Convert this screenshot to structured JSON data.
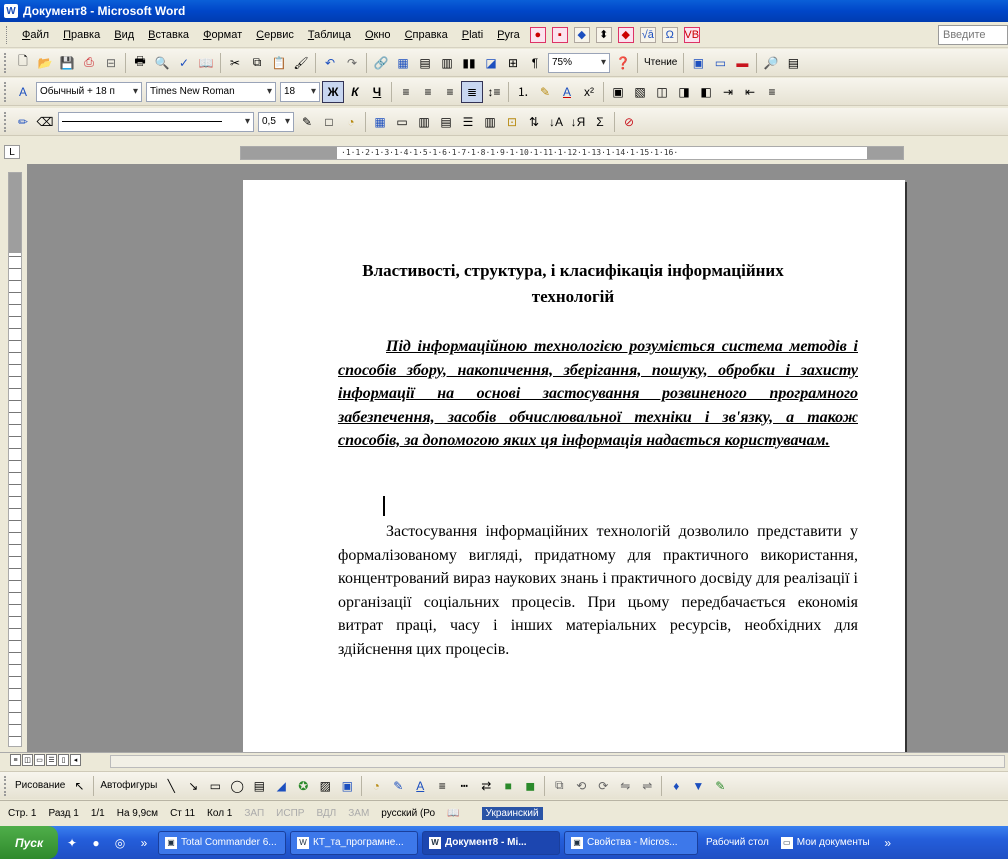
{
  "window": {
    "title": "Документ8 - Microsoft Word"
  },
  "menu": {
    "items": [
      "Файл",
      "Правка",
      "Вид",
      "Вставка",
      "Формат",
      "Сервис",
      "Таблица",
      "Окно",
      "Справка",
      "Plati",
      "Pyra"
    ],
    "help_placeholder": "Введите"
  },
  "toolbar_standard": {
    "zoom": "75%",
    "read_label": "Чтение"
  },
  "toolbar_formatting": {
    "style": "Обычный + 18 п",
    "font": "Times New Roman",
    "size": "18"
  },
  "toolbar_tables": {
    "line_weight": "0,5"
  },
  "ruler": {
    "marks": "·1·1·2·1·3·1·4·1·5·1·6·1·7·1·8·1·9·1·10·1·11·1·12·1·13·1·14·1·15·1·16·"
  },
  "document": {
    "title": "Властивості, структура, і класифікація інформаційних технологій",
    "definition": "Під інформаційною технологією розуміється система методів і способів збору, накопичення, зберігання, пошуку, обробки і захисту інформації на основі застосування розвиненого програмного забезпечення, засобів обчислювальної техніки і зв'язку, а також способів, за допомогою яких ця інформація надається користувачам.",
    "body": "Застосування інформаційних технологій дозволило представити у формалізованому вигляді, придатному для практичного використання, концентрований вираз наукових знань і практичного досвіду для реалізації і організації соціальних процесів. При цьому передбачається економія витрат праці, часу і інших матеріальних ресурсів, необхідних для здійснення цих процесів."
  },
  "drawing": {
    "draw_label": "Рисование",
    "autoshapes_label": "Автофигуры"
  },
  "status": {
    "page": "Стр. 1",
    "section": "Разд 1",
    "pages": "1/1",
    "at": "На 9,9см",
    "line": "Ст 11",
    "col": "Кол 1",
    "rec": "ЗАП",
    "trk": "ИСПР",
    "ext": "ВДЛ",
    "ovr": "ЗАМ",
    "lang": "русский (Ро",
    "kb": "Украинский"
  },
  "taskbar": {
    "start": "Пуск",
    "tasks": [
      "Total Commander 6...",
      "КТ_та_програмне...",
      "Документ8 - Mi...",
      "Свойства - Micros..."
    ],
    "desktop": "Рабочий стол",
    "mydocs": "Мои документы"
  }
}
